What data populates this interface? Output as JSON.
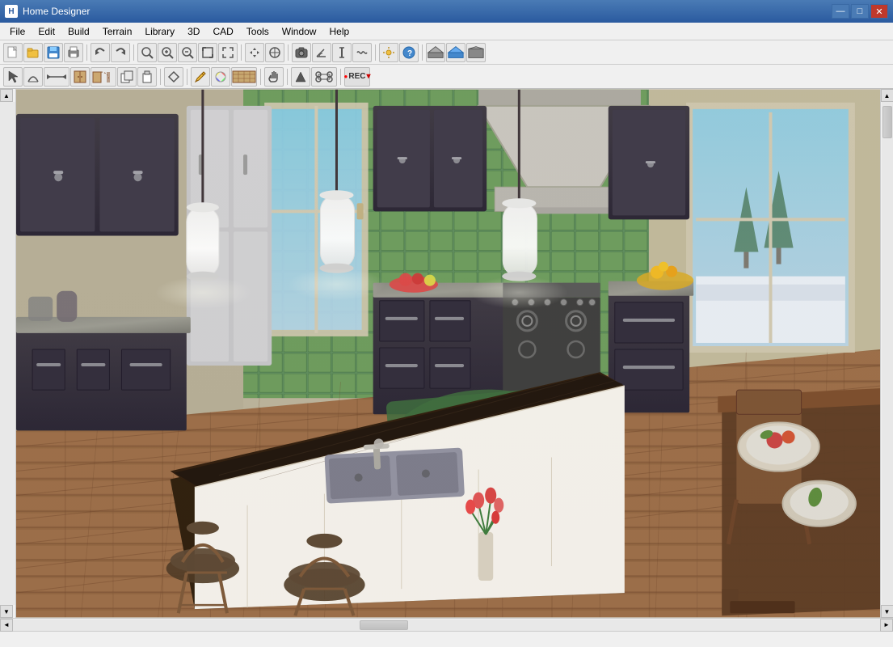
{
  "window": {
    "title": "Home Designer",
    "icon": "H"
  },
  "title_buttons": {
    "minimize": "—",
    "maximize": "□",
    "close": "✕"
  },
  "menu": {
    "items": [
      {
        "id": "file",
        "label": "File"
      },
      {
        "id": "edit",
        "label": "Edit"
      },
      {
        "id": "build",
        "label": "Build"
      },
      {
        "id": "terrain",
        "label": "Terrain"
      },
      {
        "id": "library",
        "label": "Library"
      },
      {
        "id": "3d",
        "label": "3D"
      },
      {
        "id": "cad",
        "label": "CAD"
      },
      {
        "id": "tools",
        "label": "Tools"
      },
      {
        "id": "window",
        "label": "Window"
      },
      {
        "id": "help",
        "label": "Help"
      }
    ]
  },
  "toolbar1": {
    "buttons": [
      {
        "id": "new",
        "icon": "📄",
        "tooltip": "New"
      },
      {
        "id": "open",
        "icon": "📂",
        "tooltip": "Open"
      },
      {
        "id": "save",
        "icon": "💾",
        "tooltip": "Save"
      },
      {
        "id": "print",
        "icon": "🖨",
        "tooltip": "Print"
      },
      {
        "id": "undo",
        "icon": "↩",
        "tooltip": "Undo"
      },
      {
        "id": "redo",
        "icon": "↪",
        "tooltip": "Redo"
      },
      {
        "id": "zoom-in-btn",
        "icon": "🔍",
        "tooltip": "Zoom In"
      },
      {
        "id": "zoom-plus",
        "icon": "⊕",
        "tooltip": "Zoom In"
      },
      {
        "id": "zoom-minus",
        "icon": "⊖",
        "tooltip": "Zoom Out"
      },
      {
        "id": "fit",
        "icon": "⊞",
        "tooltip": "Fit to Window"
      },
      {
        "id": "fullscreen",
        "icon": "⤢",
        "tooltip": "Full Screen"
      },
      {
        "id": "arrow-tool",
        "icon": "→",
        "tooltip": "Move"
      },
      {
        "id": "move-views",
        "icon": "⊗",
        "tooltip": "Move Views"
      },
      {
        "id": "camera",
        "icon": "📷",
        "tooltip": "Camera"
      },
      {
        "id": "angle",
        "icon": "∠",
        "tooltip": "Angle"
      },
      {
        "id": "measure",
        "icon": "↕",
        "tooltip": "Measure"
      },
      {
        "id": "sun",
        "icon": "☀",
        "tooltip": "Sun"
      },
      {
        "id": "question",
        "icon": "?",
        "tooltip": "Help"
      },
      {
        "id": "house",
        "icon": "⌂",
        "tooltip": "Floor Plan"
      },
      {
        "id": "house2",
        "icon": "⌂",
        "tooltip": "3D View"
      },
      {
        "id": "house3",
        "icon": "⌂",
        "tooltip": "Elevation View"
      }
    ]
  },
  "toolbar2": {
    "buttons": [
      {
        "id": "select",
        "icon": "↖",
        "tooltip": "Select"
      },
      {
        "id": "arc",
        "icon": "⌒",
        "tooltip": "Arc"
      },
      {
        "id": "line",
        "icon": "—",
        "tooltip": "Line"
      },
      {
        "id": "cabinet",
        "icon": "▦",
        "tooltip": "Cabinet"
      },
      {
        "id": "door",
        "icon": "🚪",
        "tooltip": "Door"
      },
      {
        "id": "copy",
        "icon": "⧉",
        "tooltip": "Copy"
      },
      {
        "id": "paste",
        "icon": "📋",
        "tooltip": "Paste"
      },
      {
        "id": "connect",
        "icon": "⬡",
        "tooltip": "Connect"
      },
      {
        "id": "pencil",
        "icon": "✏",
        "tooltip": "Draw"
      },
      {
        "id": "color",
        "icon": "🎨",
        "tooltip": "Color"
      },
      {
        "id": "texture",
        "icon": "⬢",
        "tooltip": "Texture"
      },
      {
        "id": "hand",
        "icon": "✋",
        "tooltip": "Pan"
      },
      {
        "id": "up",
        "icon": "↑",
        "tooltip": "Up"
      },
      {
        "id": "transform",
        "icon": "⊕",
        "tooltip": "Transform"
      },
      {
        "id": "rec",
        "icon": "REC",
        "tooltip": "Record"
      }
    ]
  },
  "canvas": {
    "view_type": "3D Kitchen View"
  },
  "status_bar": {
    "text": ""
  }
}
